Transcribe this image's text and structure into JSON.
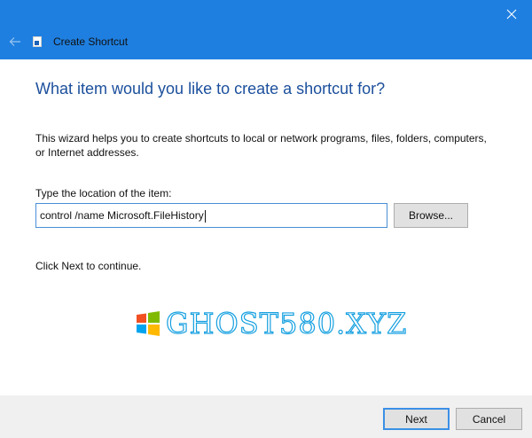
{
  "window": {
    "title": "Create Shortcut",
    "close_icon": "close-icon",
    "back_icon": "back-arrow-icon",
    "app_icon": "shortcut-icon",
    "title_bar_color": "#1e7fe0"
  },
  "content": {
    "heading": "What item would you like to create a shortcut for?",
    "description": "This wizard helps you to create shortcuts to local or network programs, files, folders, computers, or Internet addresses.",
    "location_label": "Type the location of the item:",
    "location_value": "control /name Microsoft.FileHistory",
    "browse_label": "Browse...",
    "continue_text": "Click Next to continue."
  },
  "watermark": {
    "text": "GHOST580.XYZ",
    "logo": "windows-logo-icon"
  },
  "footer": {
    "next_label": "Next",
    "cancel_label": "Cancel"
  }
}
